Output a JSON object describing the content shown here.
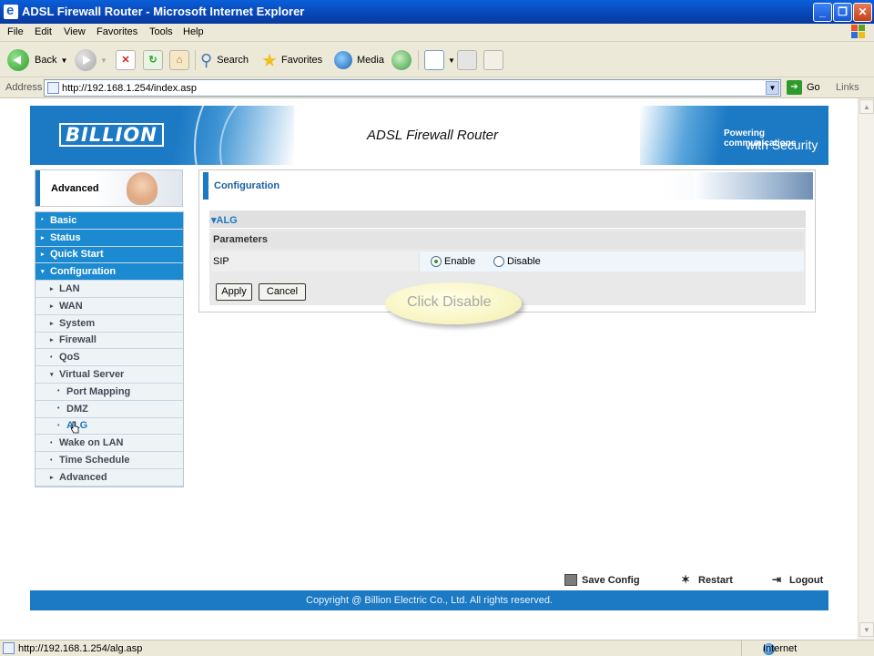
{
  "window": {
    "title": "ADSL Firewall Router - Microsoft Internet Explorer"
  },
  "menu": [
    "File",
    "Edit",
    "View",
    "Favorites",
    "Tools",
    "Help"
  ],
  "toolbar": {
    "back": "Back",
    "search": "Search",
    "favorites": "Favorites",
    "media": "Media"
  },
  "address": {
    "label": "Address",
    "url": "http://192.168.1.254/index.asp",
    "go": "Go",
    "links": "Links"
  },
  "banner": {
    "logo": "BILLION",
    "heading": "ADSL Firewall Router",
    "tagline_top": "Powering communications",
    "tagline_bottom": "with Security"
  },
  "panel": {
    "title": "Advanced"
  },
  "nav": [
    {
      "label": "Basic",
      "level": "top",
      "marker": "•"
    },
    {
      "label": "Status",
      "level": "top",
      "marker": "▸"
    },
    {
      "label": "Quick Start",
      "level": "top",
      "marker": "▸"
    },
    {
      "label": "Configuration",
      "level": "top",
      "marker": "▾"
    },
    {
      "label": "LAN",
      "level": "sub",
      "marker": "▸"
    },
    {
      "label": "WAN",
      "level": "sub",
      "marker": "▸"
    },
    {
      "label": "System",
      "level": "sub",
      "marker": "▸"
    },
    {
      "label": "Firewall",
      "level": "sub",
      "marker": "▸"
    },
    {
      "label": "QoS",
      "level": "sub",
      "marker": "•"
    },
    {
      "label": "Virtual Server",
      "level": "sub",
      "marker": "▾"
    },
    {
      "label": "Port Mapping",
      "level": "subsub",
      "marker": "•"
    },
    {
      "label": "DMZ",
      "level": "subsub",
      "marker": "•"
    },
    {
      "label": "ALG",
      "level": "subsub",
      "marker": "•"
    },
    {
      "label": "Wake on LAN",
      "level": "sub",
      "marker": "•"
    },
    {
      "label": "Time Schedule",
      "level": "sub",
      "marker": "•"
    },
    {
      "label": "Advanced",
      "level": "sub",
      "marker": "▸"
    }
  ],
  "config": {
    "title": "Configuration",
    "section": "▾ALG",
    "parameters": "Parameters",
    "sip_label": "SIP",
    "enable": "Enable",
    "disable": "Disable",
    "sip_value": "Enable",
    "apply": "Apply",
    "cancel": "Cancel"
  },
  "callout": "Click Disable",
  "footer": {
    "save": "Save Config",
    "restart": "Restart",
    "logout": "Logout",
    "copyright": "Copyright @ Billion Electric Co., Ltd. All rights reserved."
  },
  "status": {
    "url": "http://192.168.1.254/alg.asp",
    "zone": "Internet"
  },
  "colors": {
    "brand_blue": "#1c79c4",
    "nav_top": "#1c8ad0",
    "callout": "#f7f4bf"
  }
}
